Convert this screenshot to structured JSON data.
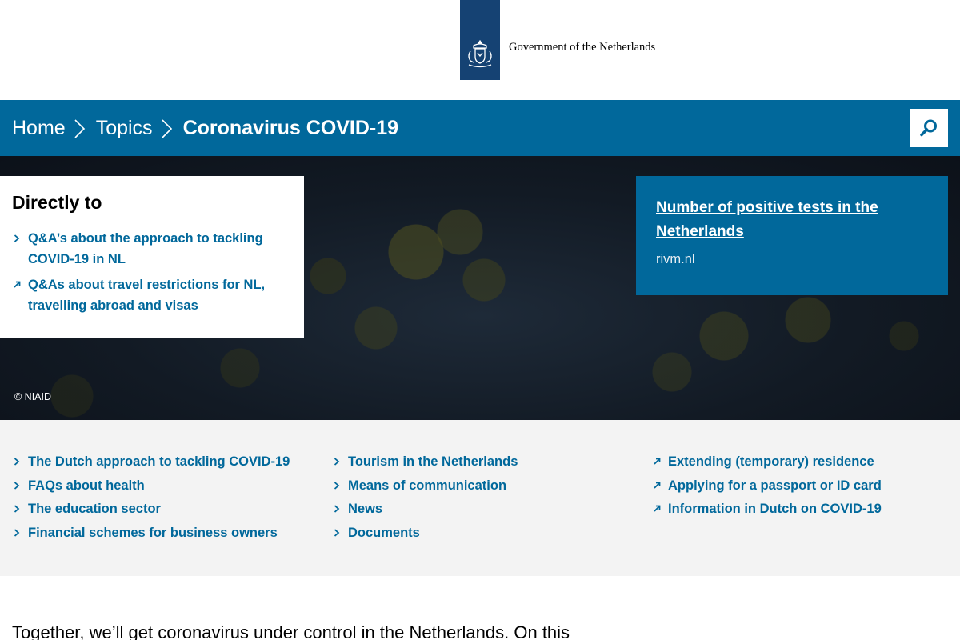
{
  "header": {
    "logo_text": "Government of the Netherlands"
  },
  "breadcrumb": {
    "home": "Home",
    "topics": "Topics",
    "current": "Coronavirus COVID-19"
  },
  "hero": {
    "directly_to": {
      "title": "Directly to",
      "items": [
        {
          "label": "Q&A’s about the approach to tackling COVID-19 in NL",
          "icon": "chevron-right-icon"
        },
        {
          "label": "Q&As about travel restrictions for NL, travelling abroad and visas",
          "icon": "external-arrow-icon"
        }
      ]
    },
    "stat_box": {
      "link": "Number of positive tests in the Netherlands",
      "source": "rivm.nl"
    },
    "credit": "©  NIAID"
  },
  "links": {
    "col1": [
      "The Dutch approach to tackling COVID-19",
      "FAQs about health",
      "The education sector",
      "Financial schemes for business owners"
    ],
    "col2": [
      "Tourism in the Netherlands",
      "Means of communication",
      "News",
      "Documents"
    ],
    "col3": [
      "Extending (temporary) residence",
      "Applying for a passport or ID card",
      "Information in Dutch on COVID-19"
    ]
  },
  "intro": "Together, we’ll get coronavirus under control in the Netherlands. On this",
  "colors": {
    "brand_blue": "#01689b",
    "logo_blue": "#154273",
    "links_bg": "#f3f3f3"
  }
}
